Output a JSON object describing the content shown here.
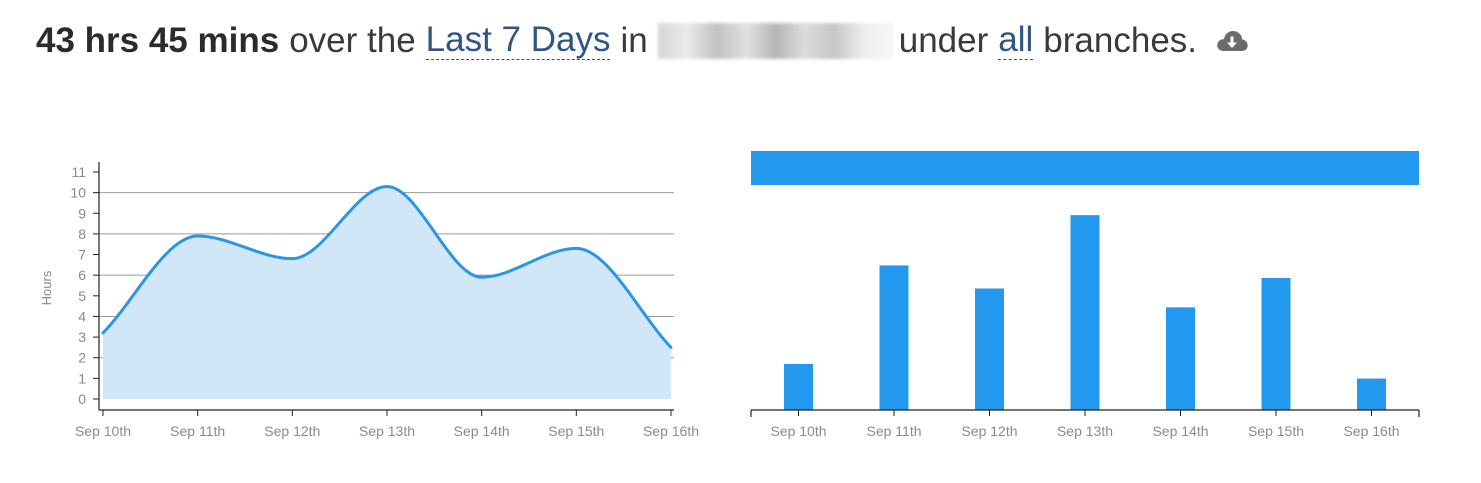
{
  "header": {
    "total": "43 hrs 45 mins",
    "text_over_the": "over the",
    "range_link": "Last 7 Days",
    "text_in": "in",
    "text_under": "under",
    "branch_link": "all",
    "text_branches": "branches.",
    "download_icon": "cloud-download-icon"
  },
  "colors": {
    "line": "#2b97e4",
    "area": "#d1e7f8",
    "bar": "#2299ee",
    "grid": "#9a9a9a",
    "tick_text": "#8a8a8a"
  },
  "chart_data": [
    {
      "type": "area",
      "categories": [
        "Sep 10th",
        "Sep 11th",
        "Sep 12th",
        "Sep 13th",
        "Sep 14th",
        "Sep 15th",
        "Sep 16th"
      ],
      "values": [
        3.2,
        7.9,
        6.8,
        10.3,
        5.9,
        7.3,
        2.5
      ],
      "ylabel": "Hours",
      "xlabel": "",
      "ylim": [
        0,
        11
      ],
      "yticks": [
        0,
        1,
        2,
        3,
        4,
        5,
        6,
        7,
        8,
        9,
        10,
        11
      ],
      "grid": "horizontal at 2, 4, 6, 8, 10"
    },
    {
      "type": "bar",
      "categories": [
        "Sep 10th",
        "Sep 11th",
        "Sep 12th",
        "Sep 13th",
        "Sep 14th",
        "Sep 15th",
        "Sep 16th"
      ],
      "values": [
        3.2,
        7.9,
        6.8,
        10.3,
        5.9,
        7.3,
        2.5
      ],
      "ylim": [
        1.0,
        11.5
      ],
      "legend": "top banner"
    }
  ]
}
